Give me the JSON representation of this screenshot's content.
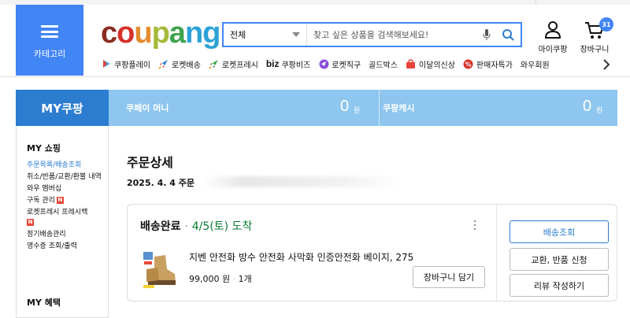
{
  "header": {
    "category_label": "카테고리",
    "logo_parts": [
      {
        "text": "c",
        "color": "#8b2b20"
      },
      {
        "text": "o",
        "color": "#d6312a"
      },
      {
        "text": "u",
        "color": "#e48c2d"
      },
      {
        "text": "p",
        "color": "#a6b938"
      },
      {
        "text": "a",
        "color": "#3fa44e"
      },
      {
        "text": "n",
        "color": "#2ca2d6"
      },
      {
        "text": "g",
        "color": "#2ca2d6"
      }
    ],
    "search": {
      "category": "전체",
      "placeholder": "찾고 싶은 상품을 검색해보세요!"
    },
    "my_coupang_label": "마이쿠팡",
    "cart_label": "장바구니",
    "cart_count": "31",
    "brand_color": "#4285f4"
  },
  "quicknav": [
    {
      "label": "쿠팡플레이",
      "icon": "play-icon"
    },
    {
      "label": "로켓배송",
      "icon": "rocket-icon"
    },
    {
      "label": "로켓프레시",
      "icon": "rocket-fresh-icon"
    },
    {
      "label": "쿠팡비즈",
      "icon": "biz-icon",
      "prefix": "biz"
    },
    {
      "label": "로켓직구",
      "icon": "globe-icon"
    },
    {
      "label": "골드박스",
      "icon": "none"
    },
    {
      "label": "이달의신상",
      "icon": "bag-icon"
    },
    {
      "label": "판매자특가",
      "icon": "percent-icon"
    },
    {
      "label": "와우회원",
      "icon": "none"
    }
  ],
  "my_bar": {
    "title": "MY쿠팡",
    "coupay_label": "쿠페이 머니",
    "coupay_amount": "0",
    "coupay_unit": "원",
    "cash_label": "쿠팡캐시",
    "cash_amount": "0",
    "cash_unit": "원"
  },
  "sidebar": {
    "heading": "MY 쇼핑",
    "items": [
      {
        "label": "주문목록/배송조회",
        "active": true
      },
      {
        "label": "취소/반품/교환/환불 내역"
      },
      {
        "label": "와우 멤버십"
      },
      {
        "label": "구독 관리",
        "badge": "N"
      },
      {
        "label": "로켓프레시 프레시백",
        "badge": "N"
      },
      {
        "label": "정기배송관리"
      },
      {
        "label": "영수증 조회/출력"
      }
    ],
    "heading2": "MY 혜택"
  },
  "order": {
    "page_title": "주문상세",
    "date_text": "2025. 4. 4 주문",
    "status": "배송완료",
    "dot": "·",
    "arrival": "4/5(토) 도착",
    "product_name": "지벤 안전화 방수 안전화 사막화 인증안전화 베이지, 275",
    "price": "99,000 원",
    "sep": "·",
    "qty": "1개",
    "add_cart_label": "장바구니 담기",
    "actions": [
      "배송조회",
      "교환, 반품 신청",
      "리뷰 작성하기"
    ],
    "status_date_color": "#0b7a32"
  }
}
